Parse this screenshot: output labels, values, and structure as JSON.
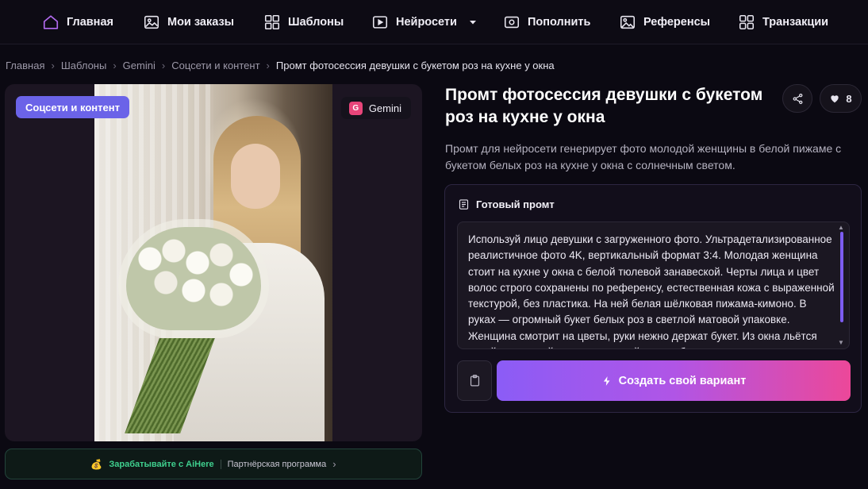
{
  "nav": {
    "items": [
      {
        "label": "Главная",
        "icon": "home-icon"
      },
      {
        "label": "Мои заказы",
        "icon": "image-icon"
      },
      {
        "label": "Шаблоны",
        "icon": "grid-icon"
      },
      {
        "label": "Нейросети",
        "icon": "play-icon"
      },
      {
        "label": "Пополнить",
        "icon": "wallet-icon"
      },
      {
        "label": "Референсы",
        "icon": "picture-icon"
      },
      {
        "label": "Транзакции",
        "icon": "grid-icon"
      }
    ]
  },
  "breadcrumb": {
    "items": [
      "Главная",
      "Шаблоны",
      "Gemini",
      "Соцсети и контент"
    ],
    "current": "Промт фотосессия девушки с букетом роз на кухне у окна"
  },
  "card": {
    "category_tag": "Соцсети и контент",
    "model_letter": "G",
    "model_name": "Gemini"
  },
  "affiliate": {
    "coin": "💰",
    "earn_text": "Зарабатывайте с AiHere",
    "program_text": "Партнёрская программа"
  },
  "product": {
    "title": "Промт фотосессия девушки с букетом роз на кухне у окна",
    "likes": "8",
    "description": "Промт для нейросети генерирует фото молодой женщины в белой пижаме с букетом белых роз на кухне у окна с солнечным светом."
  },
  "prompt": {
    "heading": "Готовый промт",
    "text": "Используй лицо девушки с загруженного фото. Ультрадетализированное реалистичное фото 4K, вертикальный формат 3:4. Молодая женщина стоит на кухне у окна с белой тюлевой занавеской. Черты лица и цвет волос строго сохранены по референсу, естественная кожа с выраженной текстурой, без пластика. На ней белая шёлковая пижама-кимоно. В руках — огромный букет белых роз в светлой матовой упаковке. Женщина смотрит на цветы, руки нежно держат букет. Из окна льётся яркий солнечный свет, создающий мягкие блики на лице",
    "create_label": "Создать свой вариант"
  },
  "colors": {
    "accent": "#6b63e8",
    "gradient_start": "#8b5cf6",
    "gradient_end": "#ec4899",
    "affiliate_green": "#3fcf8e"
  }
}
